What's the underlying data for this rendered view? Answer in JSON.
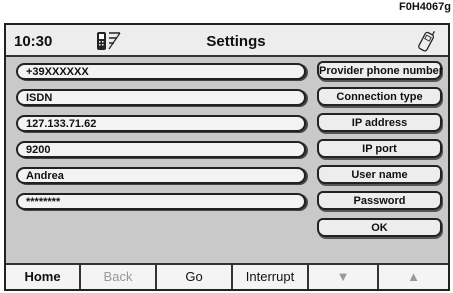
{
  "figure_ref": "F0H4067g",
  "header": {
    "time": "10:30",
    "title": "Settings",
    "phone_status_icon": "phone-signal-icon",
    "phone_icon": "mobile-phone-icon"
  },
  "fields": [
    {
      "value": "+39XXXXXX"
    },
    {
      "value": "ISDN"
    },
    {
      "value": "127.133.71.62"
    },
    {
      "value": "9200"
    },
    {
      "value": "Andrea"
    },
    {
      "value": "********"
    }
  ],
  "buttons": [
    {
      "label": "Provider phone number"
    },
    {
      "label": "Connection type"
    },
    {
      "label": "IP address"
    },
    {
      "label": "IP port"
    },
    {
      "label": "User name"
    },
    {
      "label": "Password"
    },
    {
      "label": "OK"
    }
  ],
  "bottom_bar": [
    {
      "label": "Home",
      "enabled": true
    },
    {
      "label": "Back",
      "enabled": false
    },
    {
      "label": "Go",
      "enabled": true
    },
    {
      "label": "Interrupt",
      "enabled": true
    },
    {
      "label": "▼",
      "enabled": false
    },
    {
      "label": "▲",
      "enabled": false
    }
  ],
  "colors": {
    "screen_bg": "#c9c9c9",
    "header_bg": "#ededed",
    "disabled_text": "#999999"
  }
}
